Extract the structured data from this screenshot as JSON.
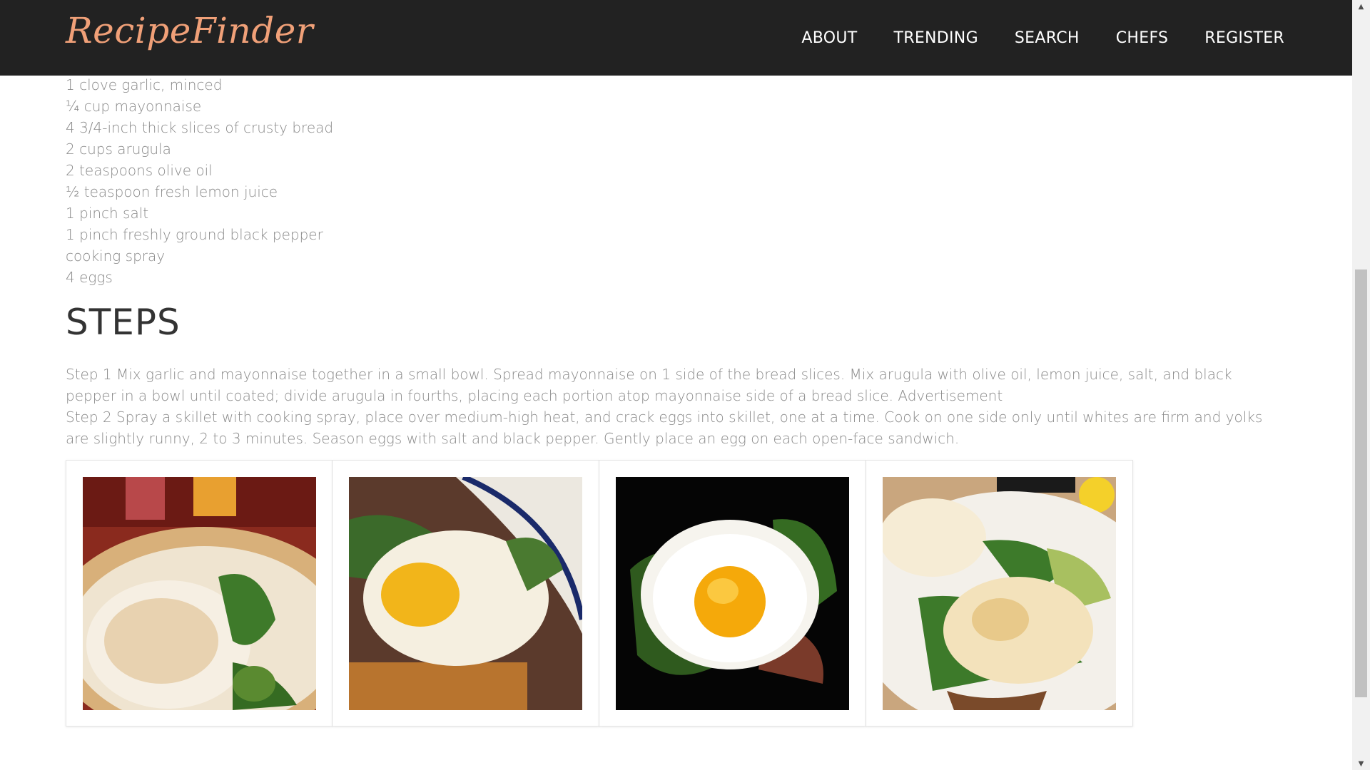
{
  "header": {
    "logo": "RecipeFinder",
    "nav": [
      "ABOUT",
      "TRENDING",
      "SEARCH",
      "CHEFS",
      "REGISTER"
    ]
  },
  "ingredients": [
    "1 clove garlic, minced",
    "¼ cup mayonnaise",
    "4 3/4-inch thick slices of crusty bread",
    "2 cups arugula",
    "2 teaspoons olive oil",
    "½ teaspoon fresh lemon juice",
    "1 pinch salt",
    "1 pinch freshly ground black pepper",
    "cooking spray",
    "4 eggs"
  ],
  "steps_heading": "STEPS",
  "steps": [
    "Step 1 Mix garlic and mayonnaise together in a small bowl. Spread mayonnaise on 1 side of the bread slices. Mix arugula with olive oil, lemon juice, salt, and black pepper in a bowl until coated; divide arugula in fourths, placing each portion atop mayonnaise side of a bread slice. Advertisement",
    "Step 2 Spray a skillet with cooking spray, place over medium-high heat, and crack eggs into skillet, one at a time. Cook on one side only until whites are firm and yolks are slightly runny, 2 to 3 minutes. Season eggs with salt and black pepper. Gently place an egg on each open-face sandwich."
  ],
  "colors": {
    "navbar_bg": "#222222",
    "logo": "#f0a078",
    "body_text": "#8a8a8a",
    "heading": "#333333"
  },
  "scrollbar": {
    "up_icon": "up-arrow-icon",
    "down_icon": "down-arrow-icon"
  }
}
